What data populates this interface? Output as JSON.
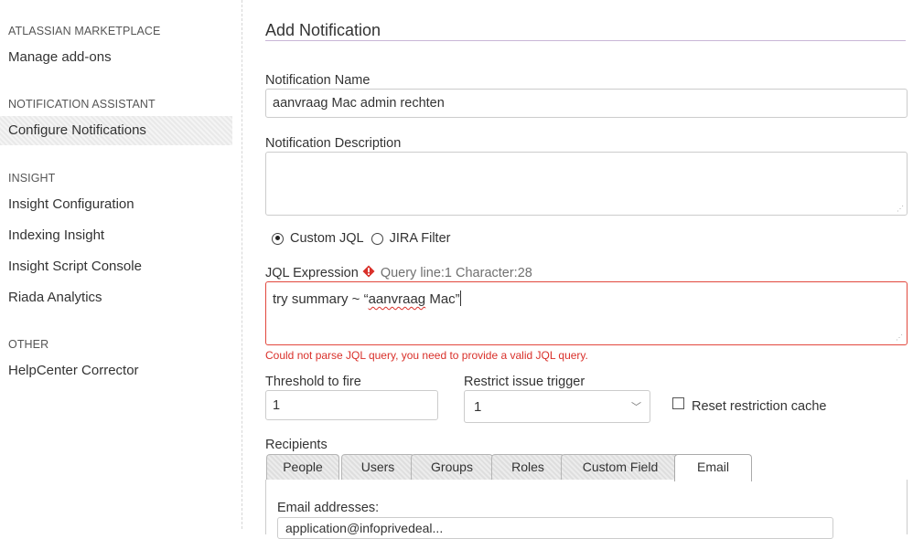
{
  "sidebar": {
    "sections": [
      {
        "heading": "ATLASSIAN MARKETPLACE",
        "items": [
          "Manage add-ons"
        ]
      },
      {
        "heading": "NOTIFICATION ASSISTANT",
        "items": [
          "Configure Notifications"
        ]
      },
      {
        "heading": "INSIGHT",
        "items": [
          "Insight Configuration",
          "Indexing Insight",
          "Insight Script Console",
          "Riada Analytics"
        ]
      },
      {
        "heading": "OTHER",
        "items": [
          "HelpCenter Corrector"
        ]
      }
    ],
    "active_item": "Configure Notifications"
  },
  "main": {
    "title": "Add Notification",
    "name_label": "Notification Name",
    "name_value": "aanvraag Mac admin rechten",
    "description_label": "Notification Description",
    "description_value": "",
    "filter_type": {
      "options": [
        "Custom JQL",
        "JIRA Filter"
      ],
      "selected": "Custom JQL"
    },
    "jql": {
      "label": "JQL Expression",
      "query_info": "Query line:1 Character:28",
      "value_prefix": "try summary ~ “",
      "value_misspelled": "aanvraag",
      "value_suffix": " Mac”",
      "error": "Could not parse JQL query, you need to provide a valid JQL query."
    },
    "threshold": {
      "label": "Threshold to fire",
      "value": "1"
    },
    "restrict": {
      "label": "Restrict issue trigger",
      "value": "1"
    },
    "reset_cache": {
      "label": "Reset restriction cache",
      "checked": false
    },
    "recipients": {
      "label": "Recipients",
      "tabs": [
        "People",
        "Users",
        "Groups",
        "Roles",
        "Custom Field",
        "Email"
      ],
      "active_tab": "Email",
      "email_label": "Email addresses:",
      "email_value": "application@infoprivedeal..."
    }
  },
  "colors": {
    "error": "#d9302a",
    "title_rule": "#c9b6d6"
  }
}
